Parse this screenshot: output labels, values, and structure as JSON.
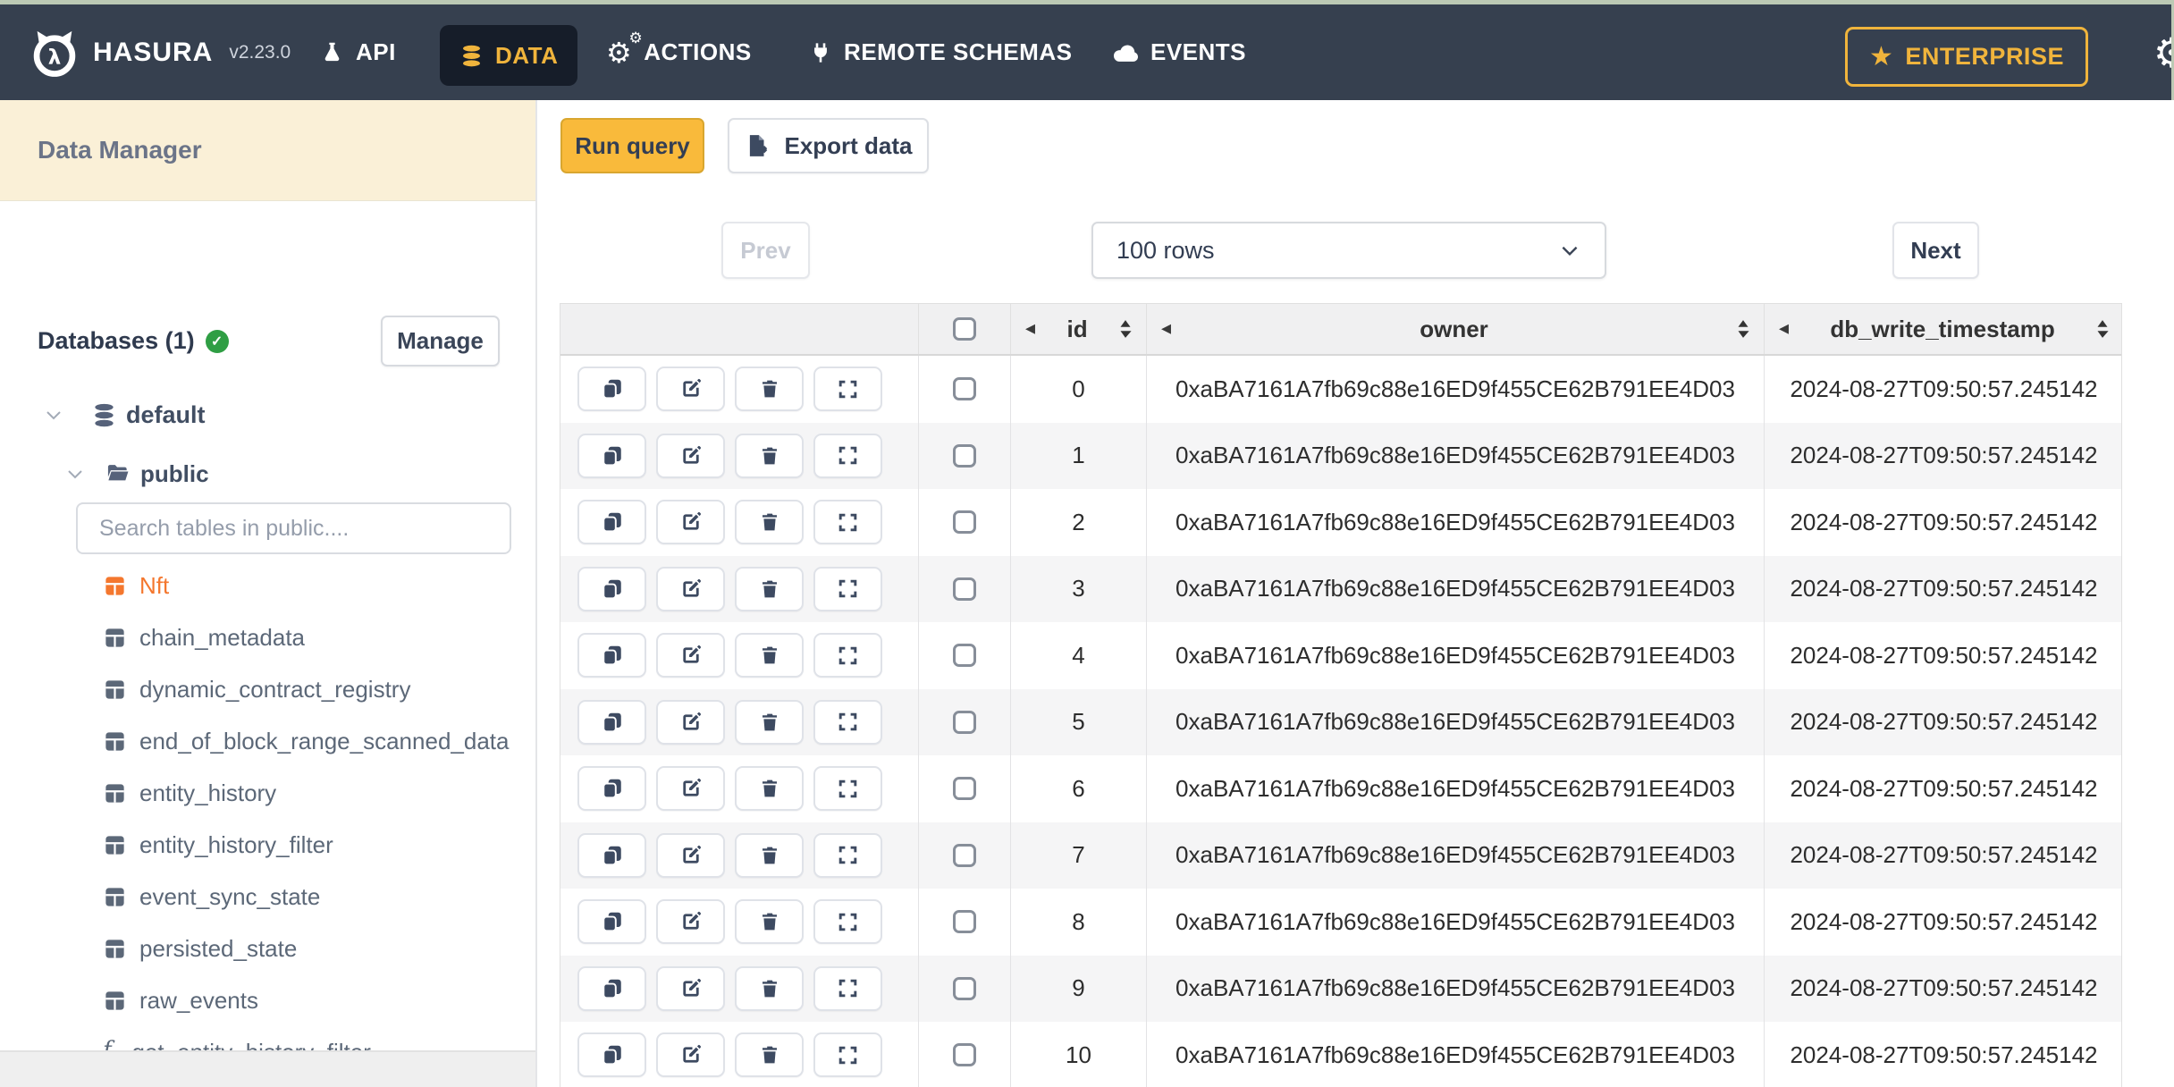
{
  "navbar": {
    "brand": "HASURA",
    "version": "v2.23.0",
    "items": [
      {
        "label": "API",
        "icon": "flask-icon"
      },
      {
        "label": "DATA",
        "icon": "database-icon",
        "active": true
      },
      {
        "label": "ACTIONS",
        "icon": "gears-icon"
      },
      {
        "label": "REMOTE SCHEMAS",
        "icon": "plug-icon"
      },
      {
        "label": "EVENTS",
        "icon": "cloud-icon"
      }
    ],
    "enterprise_label": "ENTERPRISE",
    "colors": {
      "bg": "#36404f",
      "active_bg": "#161d29",
      "accent": "#f0b43c"
    }
  },
  "icons": {
    "star": "★",
    "gear": "⚙",
    "collapse": "◂",
    "check": "✓",
    "function_f": "ƒ",
    "function_sub": "x",
    "lambda": "λ"
  },
  "sidebar": {
    "title": "Data Manager",
    "databases_label": "Databases (1)",
    "manage_label": "Manage",
    "tree": {
      "database": "default",
      "schema": "public"
    },
    "search_placeholder": "Search tables in public....",
    "tables": [
      {
        "name": "Nft",
        "type": "table",
        "active": true
      },
      {
        "name": "chain_metadata",
        "type": "table"
      },
      {
        "name": "dynamic_contract_registry",
        "type": "table"
      },
      {
        "name": "end_of_block_range_scanned_data",
        "type": "table"
      },
      {
        "name": "entity_history",
        "type": "table"
      },
      {
        "name": "entity_history_filter",
        "type": "table"
      },
      {
        "name": "event_sync_state",
        "type": "table"
      },
      {
        "name": "persisted_state",
        "type": "table"
      },
      {
        "name": "raw_events",
        "type": "table"
      },
      {
        "name": "get_entity_history_filter",
        "type": "function"
      }
    ],
    "active_color": "#f4772e"
  },
  "toolbar": {
    "run_query_label": "Run query",
    "export_data_label": "Export data"
  },
  "pagination": {
    "prev_label": "Prev",
    "next_label": "Next",
    "page_size_value": "100 rows"
  },
  "table": {
    "columns": [
      "id",
      "owner",
      "db_write_timestamp"
    ],
    "rows": [
      {
        "id": "0",
        "owner": "0xaBA7161A7fb69c88e16ED9f455CE62B791EE4D03",
        "db_write_timestamp": "2024-08-27T09:50:57.245142"
      },
      {
        "id": "1",
        "owner": "0xaBA7161A7fb69c88e16ED9f455CE62B791EE4D03",
        "db_write_timestamp": "2024-08-27T09:50:57.245142"
      },
      {
        "id": "2",
        "owner": "0xaBA7161A7fb69c88e16ED9f455CE62B791EE4D03",
        "db_write_timestamp": "2024-08-27T09:50:57.245142"
      },
      {
        "id": "3",
        "owner": "0xaBA7161A7fb69c88e16ED9f455CE62B791EE4D03",
        "db_write_timestamp": "2024-08-27T09:50:57.245142"
      },
      {
        "id": "4",
        "owner": "0xaBA7161A7fb69c88e16ED9f455CE62B791EE4D03",
        "db_write_timestamp": "2024-08-27T09:50:57.245142"
      },
      {
        "id": "5",
        "owner": "0xaBA7161A7fb69c88e16ED9f455CE62B791EE4D03",
        "db_write_timestamp": "2024-08-27T09:50:57.245142"
      },
      {
        "id": "6",
        "owner": "0xaBA7161A7fb69c88e16ED9f455CE62B791EE4D03",
        "db_write_timestamp": "2024-08-27T09:50:57.245142"
      },
      {
        "id": "7",
        "owner": "0xaBA7161A7fb69c88e16ED9f455CE62B791EE4D03",
        "db_write_timestamp": "2024-08-27T09:50:57.245142"
      },
      {
        "id": "8",
        "owner": "0xaBA7161A7fb69c88e16ED9f455CE62B791EE4D03",
        "db_write_timestamp": "2024-08-27T09:50:57.245142"
      },
      {
        "id": "9",
        "owner": "0xaBA7161A7fb69c88e16ED9f455CE62B791EE4D03",
        "db_write_timestamp": "2024-08-27T09:50:57.245142"
      },
      {
        "id": "10",
        "owner": "0xaBA7161A7fb69c88e16ED9f455CE62B791EE4D03",
        "db_write_timestamp": "2024-08-27T09:50:57.245142"
      }
    ]
  }
}
